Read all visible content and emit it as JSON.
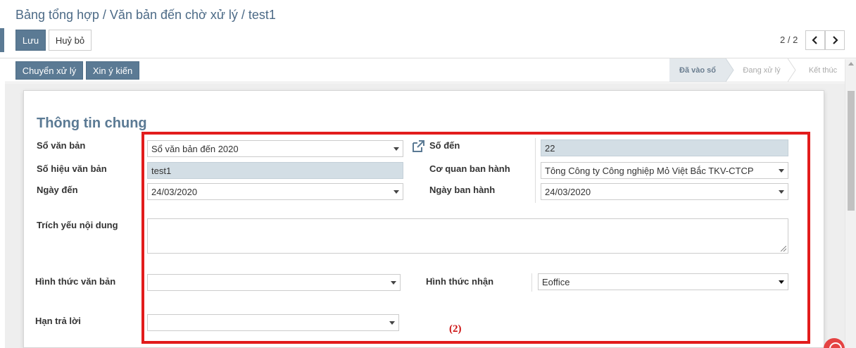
{
  "breadcrumb": {
    "part1": "Bảng tổng hợp",
    "sep1": " / ",
    "part2": "Văn bản đến chờ xử lý",
    "sep2": " / ",
    "part3": "test1"
  },
  "toolbar": {
    "save_label": "Lưu",
    "discard_label": "Huỷ bỏ"
  },
  "pager": {
    "value": "2 / 2",
    "prev_icon": "chevron-left-icon",
    "next_icon": "chevron-right-icon"
  },
  "actions": {
    "forward_label": "Chuyển xử lý",
    "opinion_label": "Xin ý kiến"
  },
  "stages": [
    {
      "label": "Đã vào sổ",
      "active": true
    },
    {
      "label": "Đang xử lý",
      "active": false
    },
    {
      "label": "Kết thúc",
      "active": false
    }
  ],
  "form": {
    "section_title": "Thông tin chung",
    "so_van_ban": {
      "label": "Sổ văn bản",
      "value": "Sổ văn bản đến 2020"
    },
    "so_den": {
      "label": "Số đến",
      "value": "22"
    },
    "so_hieu": {
      "label": "Số hiệu văn bản",
      "value": "test1"
    },
    "co_quan": {
      "label": "Cơ quan ban hành",
      "value": "Tông Công ty Công nghiệp Mỏ Việt Bắc TKV-CTCP"
    },
    "ngay_den": {
      "label": "Ngày đến",
      "value": "24/03/2020"
    },
    "ngay_ban_hanh": {
      "label": "Ngày ban hành",
      "value": "24/03/2020"
    },
    "trich_yeu": {
      "label": "Trích yếu nội dung",
      "value": ""
    },
    "hinh_thuc_vb": {
      "label": "Hình thức văn bản",
      "value": ""
    },
    "hinh_thuc_nhan": {
      "label": "Hình thức nhận",
      "value": "Eoffice"
    },
    "han_tra_loi": {
      "label": "Hạn trả lời",
      "value": ""
    }
  },
  "annotation": {
    "label": "(2)",
    "color": "#e21c1c"
  },
  "colors": {
    "accent": "#5b7a94",
    "readonly_field": "#d3dee5"
  }
}
